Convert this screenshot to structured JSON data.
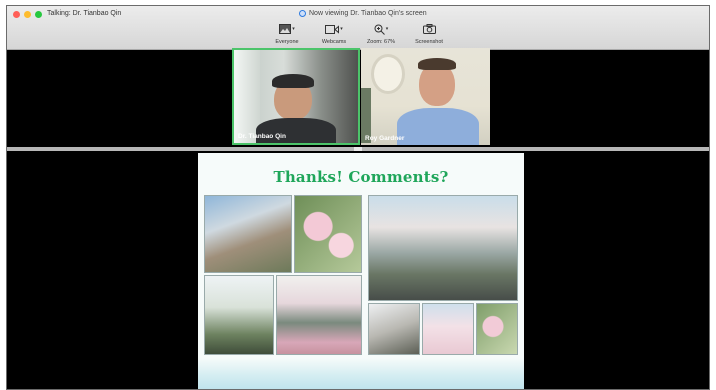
{
  "window": {
    "talking": "Talking: Dr. Tianbao Qin",
    "viewing": "Now viewing Dr. Tianbao Qin's screen"
  },
  "toolbar": {
    "items": [
      {
        "label": "Everyone",
        "icon": "gallery-icon"
      },
      {
        "label": "Webcams",
        "icon": "webcam-icon"
      },
      {
        "label": "Zoom: 67%",
        "icon": "zoom-icon"
      },
      {
        "label": "Screenshot",
        "icon": "camera-icon"
      }
    ]
  },
  "videos": [
    {
      "name": "Dr. Tianbao Qin",
      "active": true
    },
    {
      "name": "Roy Gardner",
      "active": false
    }
  ],
  "slide": {
    "title": "Thanks!  Comments?"
  },
  "colors": {
    "close": "#ff5f57",
    "minimize": "#febc2e",
    "maximize": "#28c840",
    "active_border": "#4cc46a",
    "title_green": "#1fa65a"
  }
}
